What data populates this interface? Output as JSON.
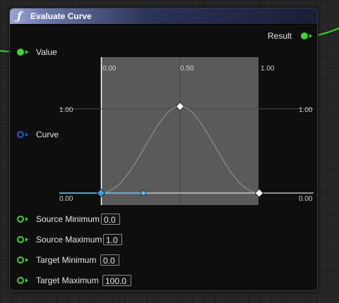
{
  "node": {
    "title": "Evaluate Curve",
    "func_icon": "ƒ"
  },
  "output": {
    "result_label": "Result"
  },
  "inputs": {
    "value_label": "Value",
    "curve_label": "Curve",
    "source_min": {
      "label": "Source Minimum",
      "value": "0.0"
    },
    "source_max": {
      "label": "Source Maximum",
      "value": "1.0"
    },
    "target_min": {
      "label": "Target Minimum",
      "value": "0.0"
    },
    "target_max": {
      "label": "Target Maximum",
      "value": "100.0"
    }
  },
  "curve_editor": {
    "top_left_label": "0.00",
    "top_mid_label": "0.50",
    "top_right_label": "1.00",
    "left_value_label": "1.00",
    "right_value_label": "1.00",
    "bottom_left_label": "0.00",
    "bottom_right_label": "0.00"
  },
  "colors": {
    "exec_green": "#3cd62e",
    "curve_blue": "#1b5fd8",
    "selected_cyan": "#5ec8e8"
  }
}
